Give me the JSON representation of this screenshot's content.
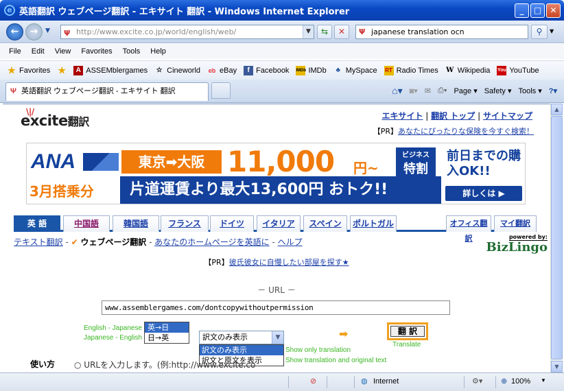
{
  "window": {
    "title": "英語翻訳 ウェブページ翻訳 - エキサイト 翻訳 - Windows Internet Explorer"
  },
  "address": {
    "url": "http://www.excite.co.jp/world/english/web/"
  },
  "search": {
    "value": "japanese translation ocn"
  },
  "menu": [
    "File",
    "Edit",
    "View",
    "Favorites",
    "Tools",
    "Help"
  ],
  "favorites": {
    "label": "Favorites",
    "items": [
      "ASSEMblergames",
      "Cineworld",
      "eBay",
      "Facebook",
      "IMDb",
      "MySpace",
      "Radio Times",
      "Wikipedia",
      "YouTube"
    ]
  },
  "tab": {
    "title": "英語翻訳 ウェブページ翻訳 - エキサイト 翻訳"
  },
  "commands": {
    "page": "Page",
    "safety": "Safety",
    "tools": "Tools"
  },
  "page": {
    "logo_main": "excite",
    "logo_sub": "翻訳",
    "toplinks": [
      "エキサイト",
      "翻訳 トップ",
      "サイトマップ"
    ],
    "pr1_prefix": "【PR】",
    "pr1_link": "あなたにぴったりな保険を今すぐ検索！",
    "banner": {
      "brand": "ANA",
      "month": "3月搭乗分",
      "route": "東京➡大阪",
      "price": "11,000",
      "price_suffix": "円~",
      "badge_top": "ビジネス",
      "badge_big": "特割",
      "tagline": "片道運賃より最大13,600円 おトク!!",
      "right_text": "前日までの購入OK!!",
      "right_button": "詳しくは ▶"
    },
    "langtabs": [
      "英 語",
      "中国語",
      "韓国語",
      "フランス",
      "ドイツ",
      "イタリア",
      "スペイン",
      "ポルトガル"
    ],
    "righttabs": [
      "オフィス翻訳",
      "マイ翻訳"
    ],
    "subnav": {
      "text_tr": "テキスト翻訳",
      "web_tr": "ウェブページ翻訳",
      "homepage": "あなたのホームページを英語に",
      "help": "ヘルプ"
    },
    "bizlingo": {
      "powered": "powered by:",
      "name": "BizLingo"
    },
    "pr2_prefix": "【PR】",
    "pr2_link": "彼氏彼女に自慢したい部屋を探す★",
    "url_heading": "－ URL －",
    "url_value": "www.assemblergames.com/dontcopywithoutpermission",
    "dir_label_1": "English - Japanese",
    "dir_label_2": "Japanese - English",
    "dir_options": [
      "英→日",
      "日→英"
    ],
    "mode_selected": "訳文のみ表示",
    "mode_options": [
      "訳文のみ表示",
      "訳文と原文を表示"
    ],
    "mode_label_1": "Show only translation",
    "mode_label_2": "Show translation and original text",
    "translate_button": "翻 訳",
    "translate_label": "Translate",
    "howto_title": "使い方",
    "howto_text": "○ URLを入力します。(例:http://www.excite.co"
  },
  "status": {
    "zone": "Internet",
    "zoom": "100%"
  }
}
